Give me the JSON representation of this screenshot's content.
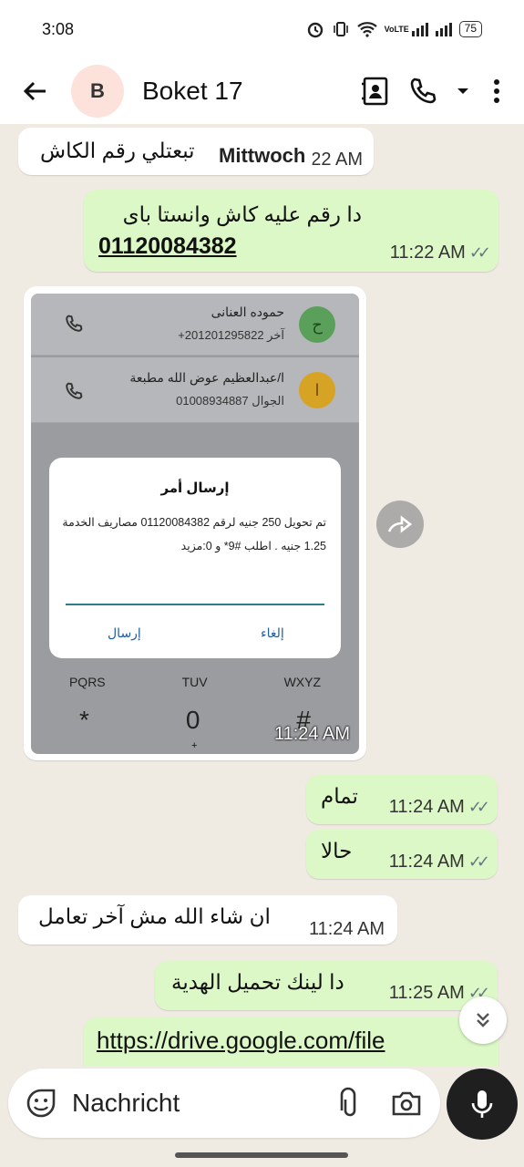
{
  "status": {
    "time": "3:08",
    "network": "VoLTE",
    "battery": "75"
  },
  "header": {
    "avatar_letter": "B",
    "contact_name": "Boket 17",
    "icons": [
      "back-arrow-icon",
      "contact-card-icon",
      "phone-icon",
      "dropdown-icon",
      "more-vert-icon"
    ]
  },
  "chat": {
    "date_chip": "Mittwoch",
    "messages": [
      {
        "dir": "in",
        "text": "تبعتلي رقم الكاش",
        "time": "11:22 AM"
      },
      {
        "dir": "out",
        "text": "دا رقم عليه كاش وانستا باى",
        "link": "01120084382",
        "time": "11:22 AM"
      },
      {
        "dir": "in",
        "type": "image",
        "time": "11:24 AM"
      },
      {
        "dir": "out",
        "text": "تمام",
        "time": "11:24 AM"
      },
      {
        "dir": "out",
        "text": "حالا",
        "time": "11:24 AM"
      },
      {
        "dir": "in",
        "text": "ان شاء الله مش آخر تعامل",
        "time": "11:24 AM"
      },
      {
        "dir": "out",
        "text": "دا لينك تحميل الهدية",
        "time": "11:25 AM"
      },
      {
        "dir": "out",
        "link": "https://drive.google.com/file"
      }
    ]
  },
  "screenshot": {
    "contact1": {
      "name": "حموده العنانى",
      "number": "آخر 201201295822+",
      "initial": "ح"
    },
    "contact2": {
      "name": "ا/عبدالعظيم عوض الله مطبعة",
      "number": "الجوال 01008934887",
      "initial": "ا"
    },
    "dialog_title": "إرسال أمر",
    "dialog_body": "تم تحويل 250 جنيه لرقم 01120084382 مصاريف الخدمة 1.25 جنيه . اطلب #9* و 0:مزيد",
    "btn_send": "إرسال",
    "btn_cancel": "إلغاء",
    "keys_row1": [
      "PQRS",
      "TUV",
      "WXYZ"
    ],
    "keys_row2": [
      "*",
      "0",
      "#"
    ],
    "zero_sub": "+"
  },
  "composer": {
    "placeholder": "Nachricht"
  }
}
